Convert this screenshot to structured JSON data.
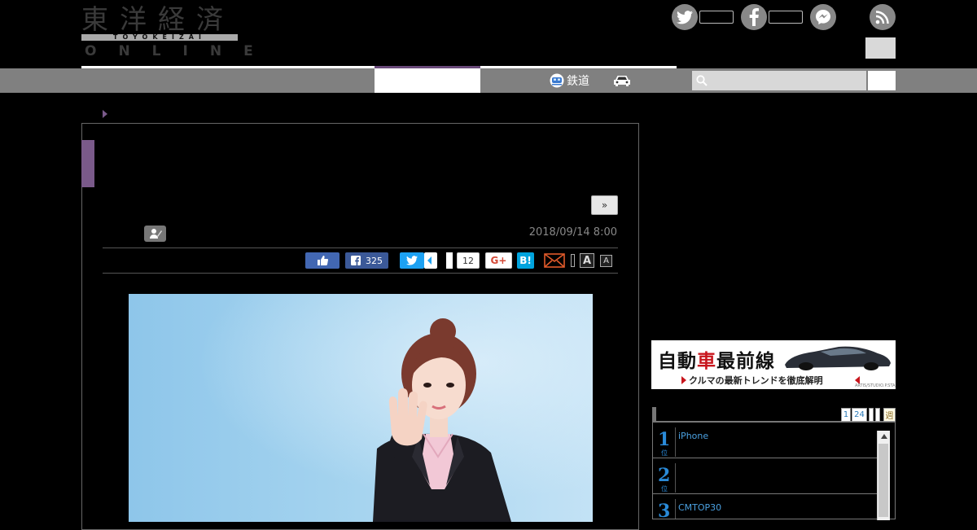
{
  "header": {
    "logo_kanji": "東洋経済",
    "logo_romaji": "TOYOKEIZAI",
    "logo_online": "ONLINE"
  },
  "nav": {
    "tetsudo_label": "鉄道"
  },
  "search": {
    "placeholder": ""
  },
  "article": {
    "next_label": "»",
    "date": "2018/09/14 8:00"
  },
  "share": {
    "fb_count": "325",
    "bubble_count": "12",
    "gplus_label": "G+",
    "hatena_label": "B!",
    "font_large_label": "A",
    "font_small_label": "A"
  },
  "banner": {
    "title_a": "自動",
    "title_red": "車",
    "title_b": "最前線",
    "subtitle": "クルマの最新トレンドを徹底解明",
    "credit": "ARTIS/STUDIO.P.STA"
  },
  "ranking": {
    "tabs": [
      "1",
      "24",
      "",
      "",
      "週"
    ],
    "items": [
      {
        "num": "1",
        "suffix": "位",
        "text": "iPhone"
      },
      {
        "num": "2",
        "suffix": "位",
        "text": ""
      },
      {
        "num": "3",
        "suffix": "位",
        "text": "CMTOP30"
      }
    ]
  },
  "colors": {
    "accent_purple": "#7a5a8a",
    "nav_gray": "#808080",
    "facebook": "#3b5998",
    "twitter": "#1da1f2",
    "hatena": "#00a4de",
    "rank_blue": "#2a8ad8"
  }
}
